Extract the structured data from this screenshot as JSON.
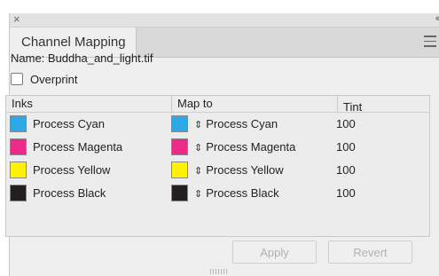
{
  "window": {
    "close_glyph": "×",
    "collapse_glyph": "‹‹"
  },
  "tab": {
    "label": "Channel Mapping"
  },
  "name_line": "Name: Buddha_and_light.tif",
  "overprint": {
    "label": "Overprint",
    "checked": false
  },
  "table": {
    "headers": {
      "inks": "Inks",
      "map_to": "Map to",
      "tint": "Tint"
    },
    "rows": [
      {
        "ink": "Process Cyan",
        "ink_color": "#2ea9e8",
        "map_to": "Process Cyan",
        "map_color": "#2ea9e8",
        "tint": "100"
      },
      {
        "ink": "Process Magenta",
        "ink_color": "#ec2a8a",
        "map_to": "Process Magenta",
        "map_color": "#ec2a8a",
        "tint": "100"
      },
      {
        "ink": "Process Yellow",
        "ink_color": "#fff200",
        "map_to": "Process Yellow",
        "map_color": "#fff200",
        "tint": "100"
      },
      {
        "ink": "Process Black",
        "ink_color": "#231f20",
        "map_to": "Process Black",
        "map_color": "#231f20",
        "tint": "100"
      }
    ]
  },
  "buttons": {
    "apply": "Apply",
    "revert": "Revert"
  },
  "updown_glyph": "⇕"
}
